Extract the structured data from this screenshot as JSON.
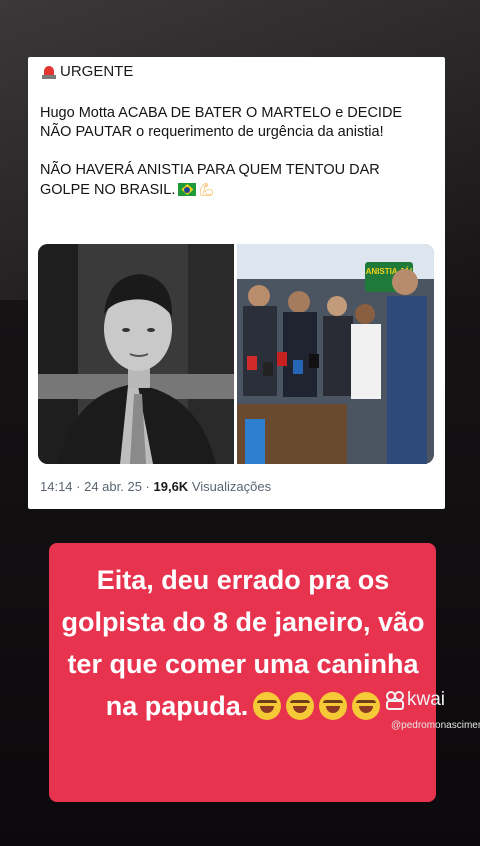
{
  "tweet": {
    "badge_label": "URGENTE",
    "badge_icon": "siren-icon",
    "paragraph_1": "Hugo Motta ACABA DE BATER O MARTELO e DECIDE NÃO PAUTAR o requerimento de urgência da anistia!",
    "paragraph_2": "NÃO HAVERÁ ANISTIA PARA QUEM TENTOU DAR GOLPE NO BRASIL.",
    "paragraph_2_emojis": [
      "brazil-flag-icon",
      "flexed-biceps-icon"
    ],
    "photo_right_sign": "ANISTIA JÁ!",
    "time": "14:14",
    "date": "24 abr. 25",
    "views_count": "19,6K",
    "views_label": "Visualizações"
  },
  "caption": {
    "text": "Eita, deu errado pra os golpista do 8 de janeiro, vão ter que comer uma caninha na papuda.",
    "emoji": "face-with-tears-of-joy-icon",
    "emoji_count": 4,
    "background": "#e8334f"
  },
  "watermark": {
    "brand": "kwai",
    "username": "@pedromonascimeno"
  }
}
